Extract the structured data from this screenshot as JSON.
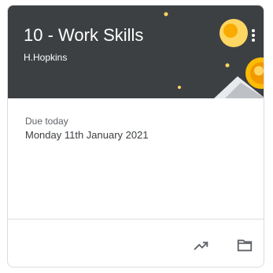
{
  "card": {
    "title": "10 - Work Skills",
    "teacher": "H.Hopkins",
    "due_label": "Due today",
    "due_date": "Monday 11th January 2021"
  },
  "icons": {
    "more": "more-vertical-icon",
    "trend": "trending-up-icon",
    "folder": "folder-icon"
  },
  "colors": {
    "header_bg": "#3c4043",
    "accent_yellow": "#fdd663",
    "accent_orange": "#f29900",
    "divider": "#dadce0",
    "icon": "#5f6368"
  }
}
